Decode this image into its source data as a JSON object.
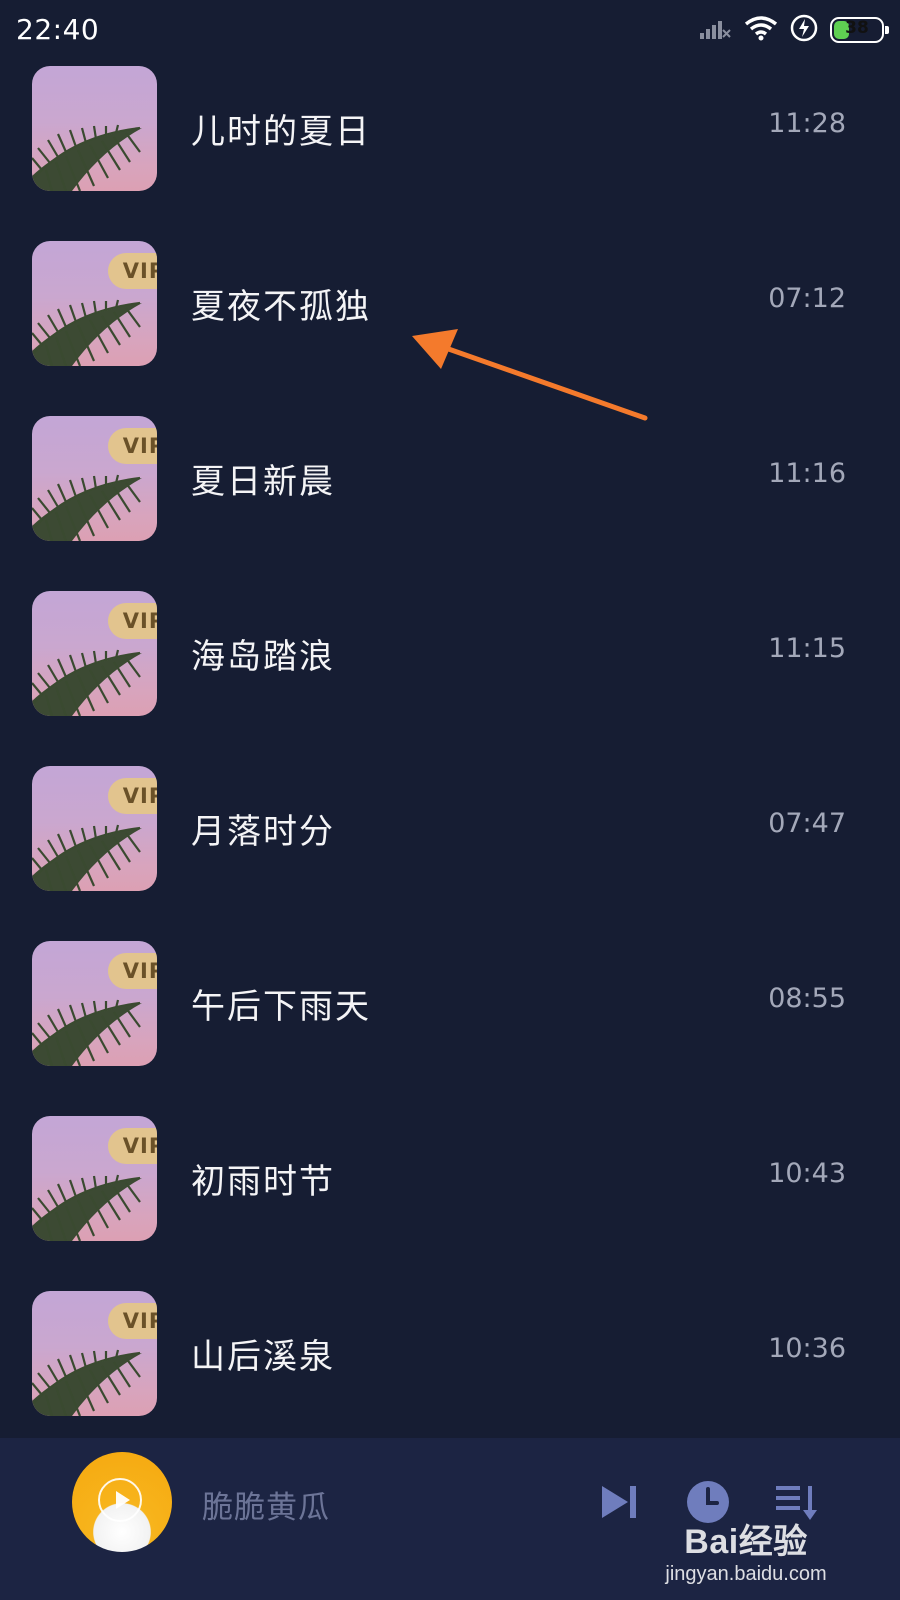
{
  "status_bar": {
    "time": "22:40",
    "battery_level": "38",
    "icons": [
      "signal-icon",
      "wifi-icon",
      "charging-icon",
      "battery-icon"
    ]
  },
  "tracks": [
    {
      "title": "儿时的夏日",
      "duration": "11:28",
      "vip": false
    },
    {
      "title": "夏夜不孤独",
      "duration": "07:12",
      "vip": true
    },
    {
      "title": "夏日新晨",
      "duration": "11:16",
      "vip": true
    },
    {
      "title": "海岛踏浪",
      "duration": "11:15",
      "vip": true
    },
    {
      "title": "月落时分",
      "duration": "07:47",
      "vip": true
    },
    {
      "title": "午后下雨天",
      "duration": "08:55",
      "vip": true
    },
    {
      "title": "初雨时节",
      "duration": "10:43",
      "vip": true
    },
    {
      "title": "山后溪泉",
      "duration": "10:36",
      "vip": true
    }
  ],
  "vip_label": "VIP",
  "mini_player": {
    "title": "脆脆黄瓜",
    "controls": [
      "next-track-icon",
      "timer-icon",
      "playlist-icon"
    ]
  },
  "watermark": {
    "brand": "Bai经验",
    "url": "jingyan.baidu.com"
  },
  "colors": {
    "background": "#161d33",
    "player_bar": "#1c2443",
    "vip_badge": "#e2c48e",
    "annotation_arrow": "#f47a2c",
    "battery": "#5fd052"
  }
}
